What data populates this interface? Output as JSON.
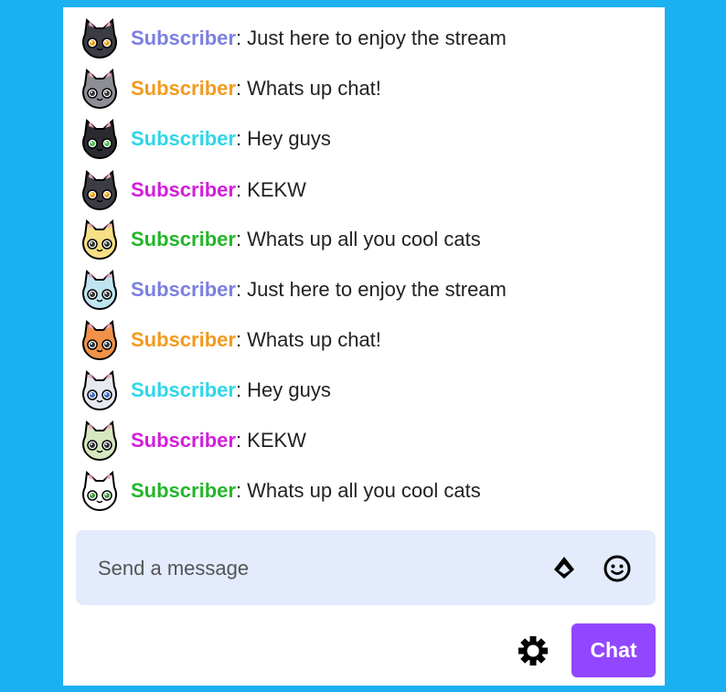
{
  "messages": [
    {
      "username": "Subscriber",
      "text": ": Just here to enjoy the stream",
      "name_color": "#7b7fe0",
      "avatar": "cat-black",
      "avatar_color": "#3c3c44",
      "eye_color": "#f0a020"
    },
    {
      "username": "Subscriber",
      "text": ": Whats up chat!",
      "name_color": "#f29a1e",
      "avatar": "cat-gray",
      "avatar_color": "#8e8e96",
      "eye_color": "#333333"
    },
    {
      "username": "Subscriber",
      "text": ": Hey guys",
      "name_color": "#2fd6e8",
      "avatar": "cat-black",
      "avatar_color": "#2a2a30",
      "eye_color": "#50c050"
    },
    {
      "username": "Subscriber",
      "text": ": KEKW",
      "name_color": "#d21edb",
      "avatar": "cat-black",
      "avatar_color": "#3c3c44",
      "eye_color": "#f0a020"
    },
    {
      "username": "Subscriber",
      "text": ": Whats up all you cool cats",
      "name_color": "#25b52a",
      "avatar": "cat-yellow",
      "avatar_color": "#f6df84",
      "eye_color": "#333333"
    },
    {
      "username": "Subscriber",
      "text": ": Just here to enjoy the stream",
      "name_color": "#7b7fe0",
      "avatar": "cat-rainbow",
      "avatar_color": "#bfe6f0",
      "eye_color": "#333333"
    },
    {
      "username": "Subscriber",
      "text": ": Whats up chat!",
      "name_color": "#f29a1e",
      "avatar": "cat-orange",
      "avatar_color": "#f2924a",
      "eye_color": "#333333"
    },
    {
      "username": "Subscriber",
      "text": ": Hey guys",
      "name_color": "#2fd6e8",
      "avatar": "cat-white",
      "avatar_color": "#e6e8f2",
      "eye_color": "#3a6ad0"
    },
    {
      "username": "Subscriber",
      "text": ": KEKW",
      "name_color": "#d21edb",
      "avatar": "cat-rainbow",
      "avatar_color": "#d6e8c0",
      "eye_color": "#333333"
    },
    {
      "username": "Subscriber",
      "text": ": Whats up all you cool cats",
      "name_color": "#25b52a",
      "avatar": "cat-white",
      "avatar_color": "#ffffff",
      "eye_color": "#40a040"
    }
  ],
  "input": {
    "placeholder": "Send a message"
  },
  "icons": {
    "bits": "bits-icon",
    "emote": "smiley-icon",
    "settings": "gear-icon"
  },
  "chat_button": {
    "label": "Chat"
  },
  "colors": {
    "background": "#1bb0f2",
    "panel": "#ffffff",
    "input_bg": "#e3ebfc",
    "button": "#9147ff"
  }
}
